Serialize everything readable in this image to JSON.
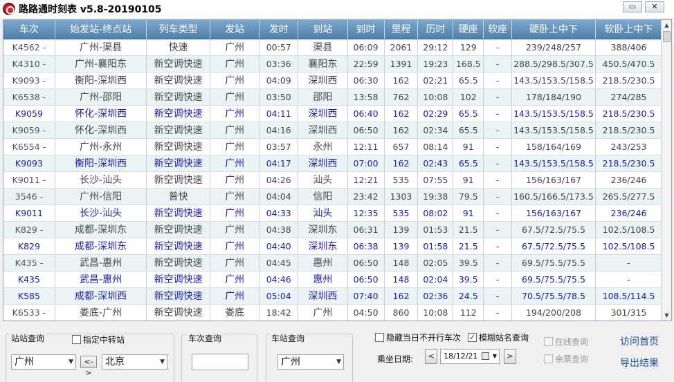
{
  "window": {
    "title": "路路通时刻表 v5.8-20190105",
    "min_label": "▭",
    "close_label": "✕"
  },
  "columns": [
    "车次",
    "始发站-终点站",
    "列车类型",
    "发站",
    "发时",
    "到站",
    "到时",
    "里程",
    "历时",
    "硬座",
    "软座",
    "硬卧上中下",
    "软卧上中下"
  ],
  "rows": [
    {
      "train": "K4562 -",
      "route": "广州-渠县",
      "type": "快速",
      "from": "广州",
      "dep": "00:57",
      "to": "渠县",
      "arr": "06:09",
      "dist": "2061",
      "dur": "29:12",
      "hs": "129",
      "ss": "-",
      "hb": "239/248/257",
      "sb": "388/406",
      "hl": false
    },
    {
      "train": "K4310 -",
      "route": "广州-襄阳东",
      "type": "新空调快速",
      "from": "广州",
      "dep": "03:36",
      "to": "襄阳东",
      "arr": "22:59",
      "dist": "1391",
      "dur": "19:23",
      "hs": "168.5",
      "ss": "-",
      "hb": "288.5/298.5/307.5",
      "sb": "450.5/470.5",
      "hl": false
    },
    {
      "train": "K9093 -",
      "route": "衡阳-深圳西",
      "type": "新空调快速",
      "from": "广州",
      "dep": "04:09",
      "to": "深圳西",
      "arr": "06:30",
      "dist": "162",
      "dur": "02:21",
      "hs": "65.5",
      "ss": "-",
      "hb": "143.5/153.5/158.5",
      "sb": "218.5/230.5",
      "hl": false
    },
    {
      "train": "K6538 -",
      "route": "广州-邵阳",
      "type": "新空调快速",
      "from": "广州",
      "dep": "03:50",
      "to": "邵阳",
      "arr": "13:58",
      "dist": "762",
      "dur": "10:08",
      "hs": "102",
      "ss": "-",
      "hb": "178/184/190",
      "sb": "274/285",
      "hl": false
    },
    {
      "train": "K9059",
      "route": "怀化-深圳西",
      "type": "新空调快速",
      "from": "广州",
      "dep": "04:11",
      "to": "深圳西",
      "arr": "06:40",
      "dist": "162",
      "dur": "02:29",
      "hs": "65.5",
      "ss": "-",
      "hb": "143.5/153.5/158.5",
      "sb": "218.5/230.5",
      "hl": true
    },
    {
      "train": "K9059 -",
      "route": "怀化-深圳西",
      "type": "新空调快速",
      "from": "广州",
      "dep": "04:16",
      "to": "深圳西",
      "arr": "06:50",
      "dist": "162",
      "dur": "02:34",
      "hs": "65.5",
      "ss": "-",
      "hb": "143.5/153.5/158.5",
      "sb": "218.5/230.5",
      "hl": false
    },
    {
      "train": "K6554 -",
      "route": "广州-永州",
      "type": "新空调快速",
      "from": "广州",
      "dep": "03:57",
      "to": "永州",
      "arr": "12:11",
      "dist": "657",
      "dur": "08:14",
      "hs": "91",
      "ss": "-",
      "hb": "158/164/169",
      "sb": "243/253",
      "hl": false
    },
    {
      "train": "K9093",
      "route": "衡阳-深圳西",
      "type": "新空调快速",
      "from": "广州",
      "dep": "04:17",
      "to": "深圳西",
      "arr": "07:00",
      "dist": "162",
      "dur": "02:43",
      "hs": "65.5",
      "ss": "-",
      "hb": "143.5/153.5/158.5",
      "sb": "218.5/230.5",
      "hl": true
    },
    {
      "train": "K9011 -",
      "route": "长沙-汕头",
      "type": "新空调快速",
      "from": "广州",
      "dep": "04:26",
      "to": "汕头",
      "arr": "12:21",
      "dist": "535",
      "dur": "07:55",
      "hs": "91",
      "ss": "-",
      "hb": "156/163/167",
      "sb": "236/246",
      "hl": false
    },
    {
      "train": "3546 -",
      "route": "广州-信阳",
      "type": "普快",
      "from": "广州",
      "dep": "04:04",
      "to": "信阳",
      "arr": "23:42",
      "dist": "1303",
      "dur": "19:38",
      "hs": "79.5",
      "ss": "-",
      "hb": "160.5/166.5/173.5",
      "sb": "265.5/277.5",
      "hl": false
    },
    {
      "train": "K9011",
      "route": "长沙-汕头",
      "type": "新空调快速",
      "from": "广州",
      "dep": "04:33",
      "to": "汕头",
      "arr": "12:35",
      "dist": "535",
      "dur": "08:02",
      "hs": "91",
      "ss": "-",
      "hb": "156/163/167",
      "sb": "236/246",
      "hl": true
    },
    {
      "train": "K829 -",
      "route": "成都-深圳东",
      "type": "新空调快速",
      "from": "广州",
      "dep": "04:38",
      "to": "深圳东",
      "arr": "06:31",
      "dist": "139",
      "dur": "01:53",
      "hs": "21.5",
      "ss": "-",
      "hb": "67.5/72.5/75.5",
      "sb": "102.5/108.5",
      "hl": false
    },
    {
      "train": "K829",
      "route": "成都-深圳东",
      "type": "新空调快速",
      "from": "广州",
      "dep": "04:40",
      "to": "深圳东",
      "arr": "06:38",
      "dist": "139",
      "dur": "01:58",
      "hs": "21.5",
      "ss": "-",
      "hb": "67.5/72.5/75.5",
      "sb": "102.5/108.5",
      "hl": true
    },
    {
      "train": "K435 -",
      "route": "武昌-惠州",
      "type": "新空调快速",
      "from": "广州",
      "dep": "04:45",
      "to": "惠州",
      "arr": "06:50",
      "dist": "148",
      "dur": "02:05",
      "hs": "39.5",
      "ss": "-",
      "hb": "69.5/75.5/75.5",
      "sb": "-",
      "hl": false
    },
    {
      "train": "K435",
      "route": "武昌-惠州",
      "type": "新空调快速",
      "from": "广州",
      "dep": "04:46",
      "to": "惠州",
      "arr": "06:50",
      "dist": "148",
      "dur": "02:04",
      "hs": "39.5",
      "ss": "-",
      "hb": "69.5/75.5/75.5",
      "sb": "-",
      "hl": true
    },
    {
      "train": "K585",
      "route": "成都-深圳西",
      "type": "新空调快速",
      "from": "广州",
      "dep": "05:04",
      "to": "深圳西",
      "arr": "07:40",
      "dist": "162",
      "dur": "02:36",
      "hs": "24.5",
      "ss": "-",
      "hb": "70.5/75.5/78.5",
      "sb": "108.5/114.5",
      "hl": true
    },
    {
      "train": "K6533 -",
      "route": "娄底-广州",
      "type": "新空调快速",
      "from": "娄底",
      "dep": "18:42",
      "to": "广州",
      "arr": "04:50",
      "dist": "860",
      "dur": "10:08",
      "hs": "112",
      "ss": "-",
      "hb": "194/200/208",
      "sb": "301/315",
      "hl": false
    }
  ],
  "bottom": {
    "station_query_label": "站站查询",
    "transfer_label": "指定中转站",
    "from_station": "广州",
    "swap_label": "<->",
    "to_station": "北京",
    "train_query_label": "车次查询",
    "train_query_value": "",
    "station_train_label": "车站查询",
    "station_value": "广州",
    "hide_label": "隐藏当日不开行车次",
    "fuzzy_label": "模糊站名查询",
    "date_label": "乘坐日期:",
    "prev_label": "<",
    "date_value": "18/12/21",
    "next_label": ">",
    "online_label": "在线查询",
    "ticket_label": "余票查询",
    "home_link": "访问首页",
    "export_link": "导出结果",
    "hide_checked": false,
    "fuzzy_checked": true,
    "transfer_checked": false
  },
  "colors": {
    "highlight_text": "#1a1ab8",
    "header_bg": "#5c8cb8",
    "alt_row": "#eaf4f4"
  }
}
